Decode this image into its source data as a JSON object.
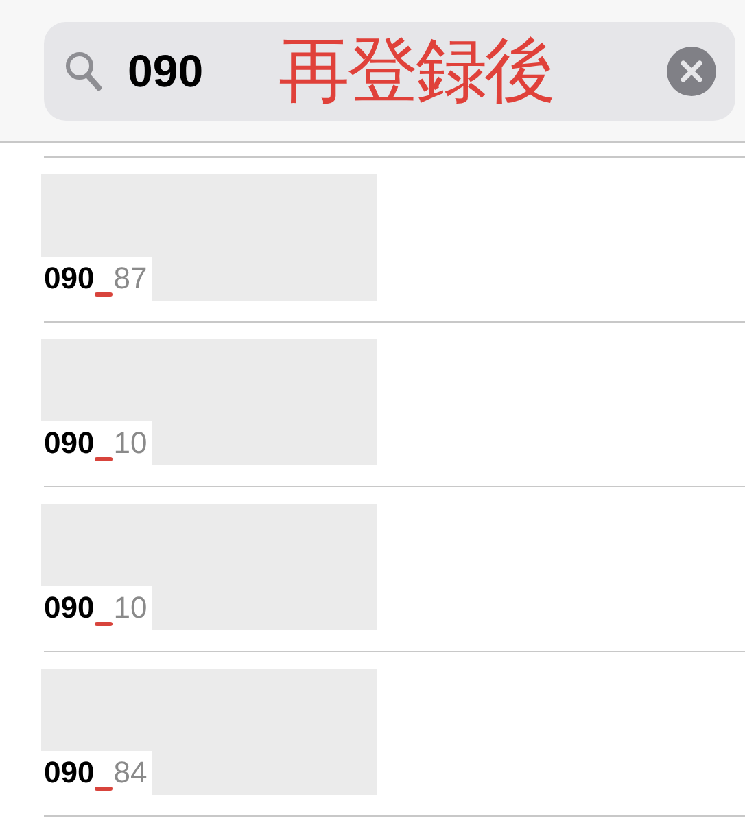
{
  "search": {
    "value": "090",
    "annotation": "再登録後"
  },
  "results": [
    {
      "match": "090",
      "rest": "87"
    },
    {
      "match": "090",
      "rest": "10"
    },
    {
      "match": "090",
      "rest": "10"
    },
    {
      "match": "090",
      "rest": "84"
    }
  ]
}
